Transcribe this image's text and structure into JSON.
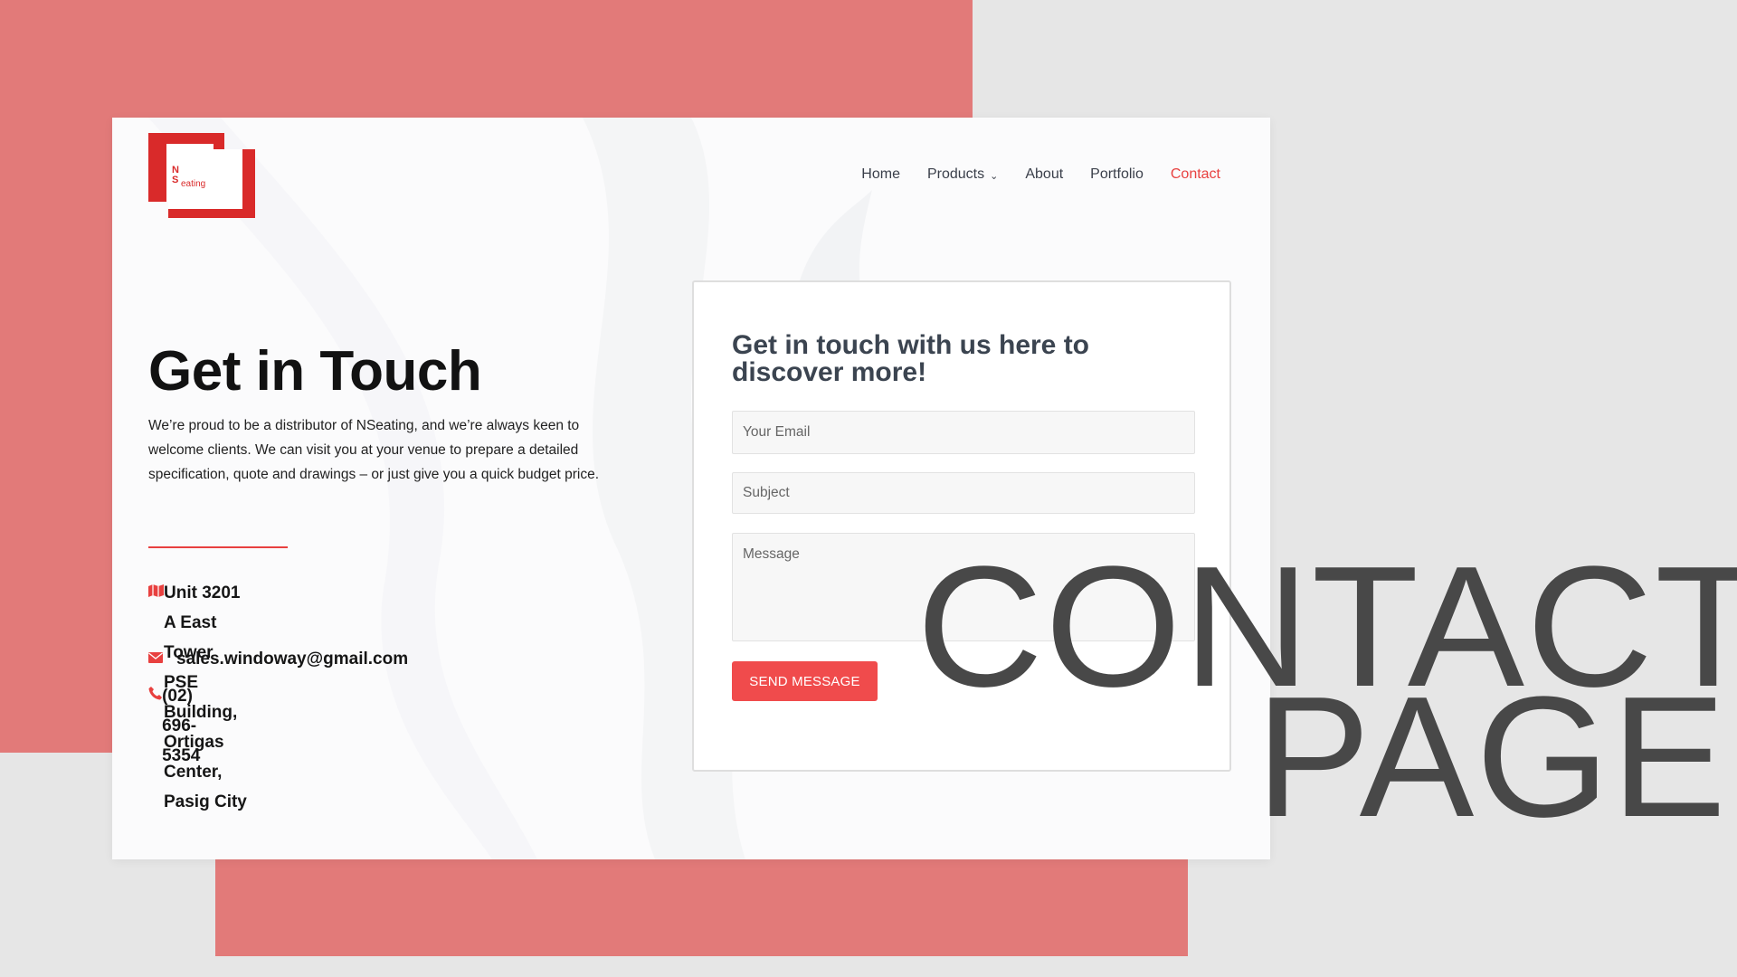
{
  "colors": {
    "accent": "#e8403f",
    "coral_background": "#e27a79",
    "button": "#f04b4c",
    "heading_dark": "#121212",
    "form_title": "#3b4450",
    "overlay_text": "#484848"
  },
  "logo": {
    "mark": "N\nS",
    "word": "eating"
  },
  "nav": {
    "items": [
      {
        "label": "Home"
      },
      {
        "label": "Products",
        "has_dropdown": true
      },
      {
        "label": "About"
      },
      {
        "label": "Portfolio"
      },
      {
        "label": "Contact",
        "active": true
      }
    ]
  },
  "hero": {
    "title": "Get in Touch",
    "body": "We’re proud to be a distributor of NSeating, and we’re always keen to welcome clients. We can visit you at your venue to prepare a detailed specification, quote and drawings – or just give you a quick budget price."
  },
  "contact": {
    "address_line1": "Unit 3201 A East Tower PSE Building, Ortigas Center,",
    "address_line2": "Pasig City",
    "email": "sales.windoway@gmail.com",
    "phone": "(02) 696-5354",
    "icons": [
      "map-icon",
      "envelope-icon",
      "phone-icon"
    ]
  },
  "form": {
    "title": "Get in touch with us here to discover more!",
    "email_placeholder": "Your Email",
    "subject_placeholder": "Subject",
    "message_placeholder": "Message",
    "submit_label": "SEND MESSAGE"
  },
  "overlay": {
    "line1": "CONTACT",
    "line2": "PAGE"
  }
}
